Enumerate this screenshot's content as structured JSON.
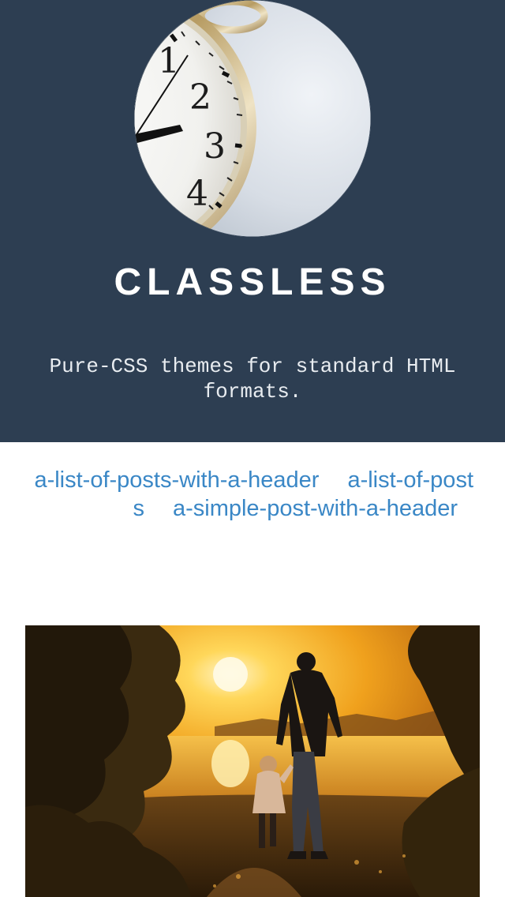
{
  "header": {
    "logo": {
      "icon": "pocket-watch-icon"
    },
    "title": "CLASSLESS",
    "tagline": "Pure-CSS themes for standard HTML formats.",
    "background": "#2d3e52"
  },
  "nav": {
    "links": [
      {
        "label": "a-list-of-posts-with-a-header"
      },
      {
        "label": "a-list-of-posts"
      },
      {
        "label": "a-simple-post-with-a-header"
      }
    ],
    "link_color": "#3a87c6"
  },
  "hero": {
    "image": "sunset-father-child-photo"
  }
}
